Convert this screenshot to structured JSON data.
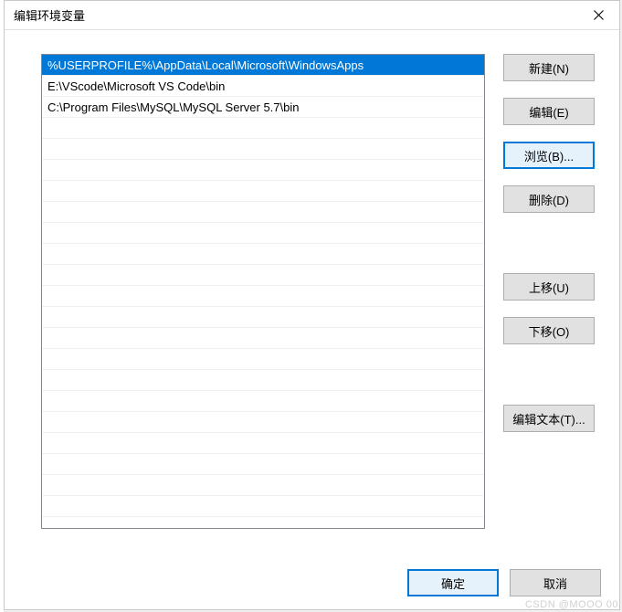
{
  "dialog": {
    "title": "编辑环境变量",
    "list_items": [
      "%USERPROFILE%\\AppData\\Local\\Microsoft\\WindowsApps",
      "E:\\VScode\\Microsoft VS Code\\bin",
      "C:\\Program Files\\MySQL\\MySQL Server 5.7\\bin"
    ],
    "selected_index": 0,
    "buttons": {
      "new": "新建(N)",
      "edit": "编辑(E)",
      "browse": "浏览(B)...",
      "delete": "删除(D)",
      "moveup": "上移(U)",
      "movedown": "下移(O)",
      "edittext": "编辑文本(T)...",
      "ok": "确定",
      "cancel": "取消"
    }
  },
  "watermark": "CSDN @MOOO 00"
}
